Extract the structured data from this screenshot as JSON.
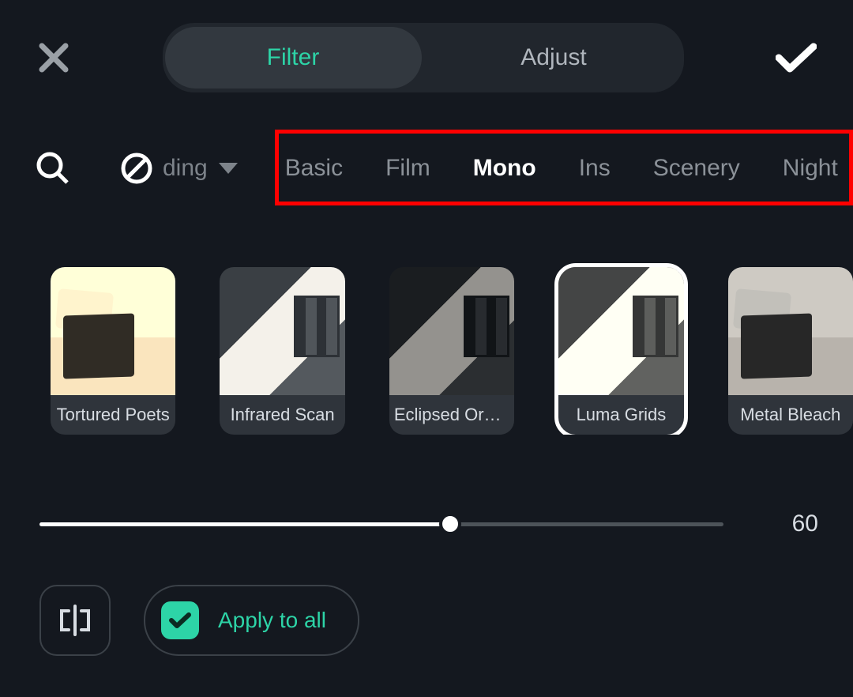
{
  "tabs": {
    "filter": "Filter",
    "adjust": "Adjust",
    "active": "filter"
  },
  "dropdown_partial": "ding",
  "categories": [
    "Basic",
    "Film",
    "Mono",
    "Ins",
    "Scenery",
    "Night"
  ],
  "active_category": "Mono",
  "filters": [
    {
      "label": "Tortured Poets",
      "style": "chair sepia"
    },
    {
      "label": "Infrared Scan",
      "style": "window"
    },
    {
      "label": "Eclipsed Ora…",
      "style": "window dim"
    },
    {
      "label": "Luma Grids",
      "style": "window warm",
      "selected": true
    },
    {
      "label": "Metal Bleach",
      "style": "chair cool"
    }
  ],
  "slider_value": 60,
  "apply_all_label": "Apply to all",
  "apply_all_checked": true
}
